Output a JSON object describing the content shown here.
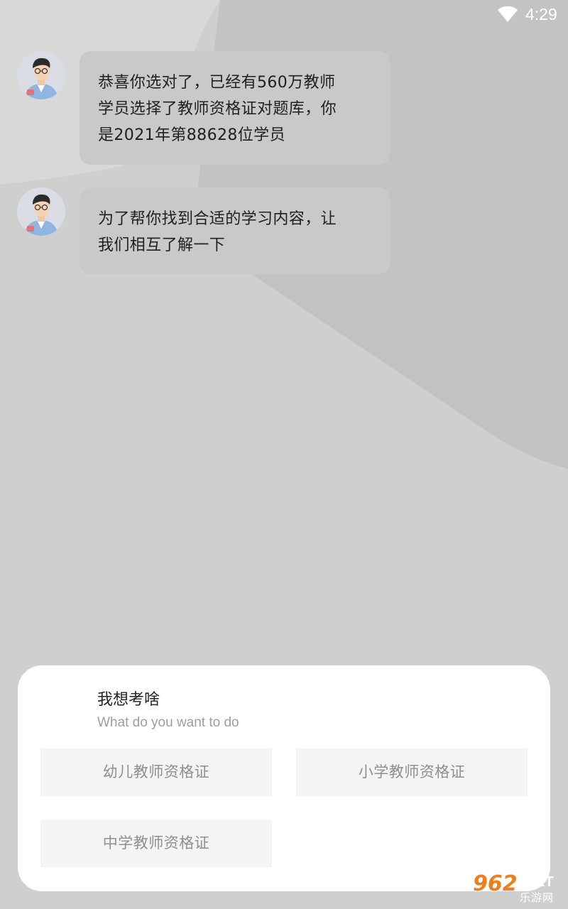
{
  "status_bar": {
    "time": "4:29",
    "wifi_icon": "wifi-icon"
  },
  "colors": {
    "background": "#cfcfcf",
    "bubble": "#c9c9ca",
    "card": "#ffffff",
    "option_bg": "#f4f4f4",
    "option_text": "#8f8f8f",
    "watermark_orange": "#f07d1e"
  },
  "chat": {
    "messages": [
      {
        "avatar": "teacher-avatar",
        "lines": [
          "恭喜你选对了，已经有560万教师",
          "学员选择了教师资格证对题库，你",
          "是2021年第88628位学员"
        ]
      },
      {
        "avatar": "teacher-avatar",
        "lines": [
          "为了帮你找到合适的学习内容，让",
          "我们相互了解一下"
        ]
      }
    ]
  },
  "question_card": {
    "title": "我想考啥",
    "subtitle": "What do you want to do",
    "options": [
      {
        "label": "幼儿教师资格证"
      },
      {
        "label": "小学教师资格证"
      },
      {
        "label": "中学教师资格证"
      }
    ]
  },
  "watermark": {
    "logo_number": "962",
    "net": ".NET",
    "site_name": "乐游网"
  }
}
